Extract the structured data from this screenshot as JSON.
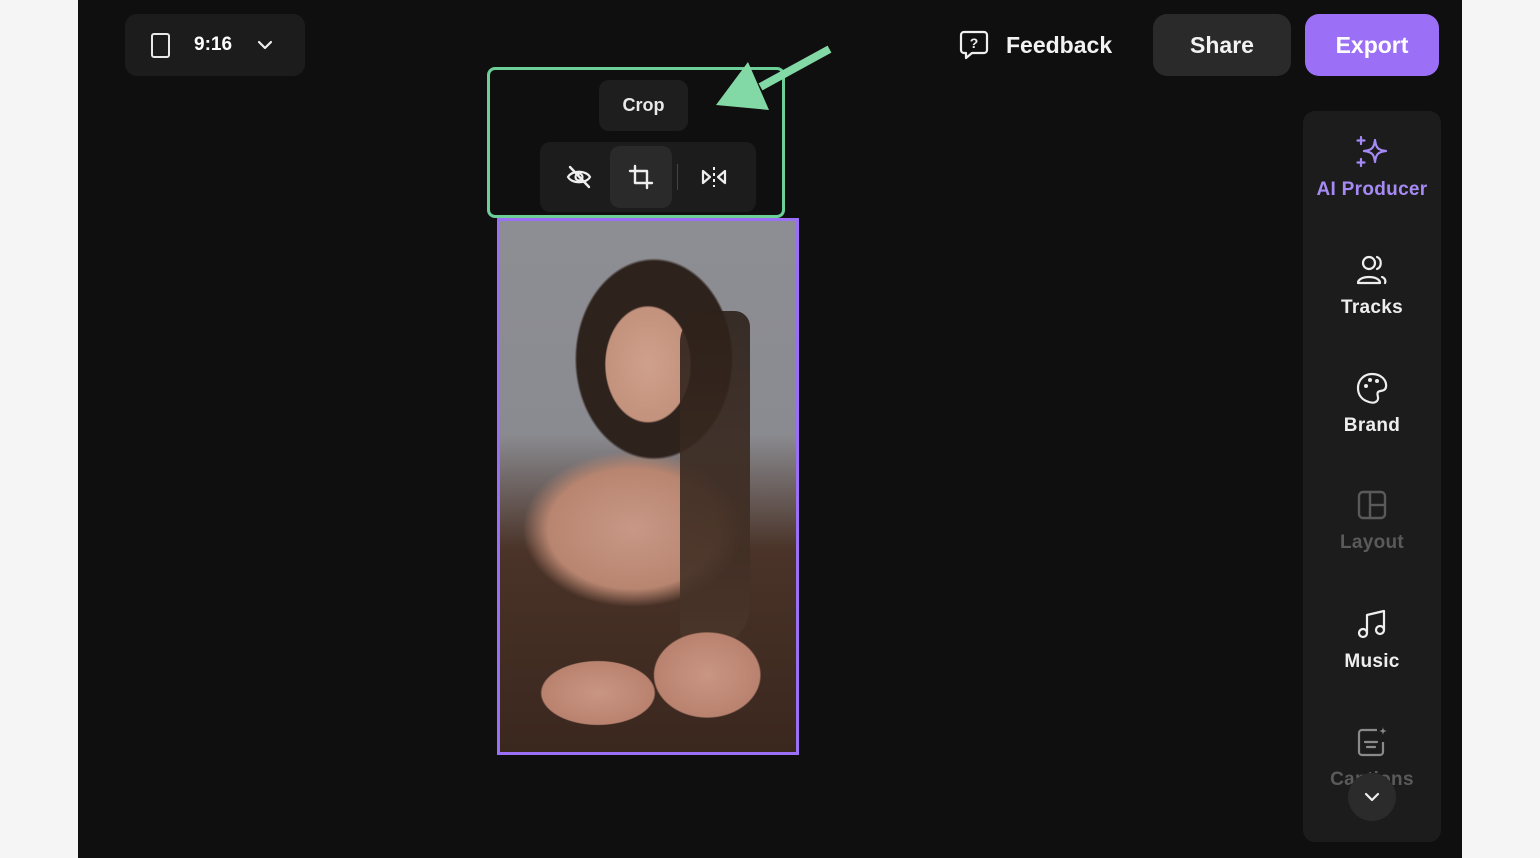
{
  "topbar": {
    "aspect_ratio": "9:16",
    "feedback_label": "Feedback",
    "share_label": "Share",
    "export_label": "Export"
  },
  "toolbar": {
    "tooltip": "Crop",
    "buttons": [
      {
        "name": "hide",
        "icon": "eye-off-icon"
      },
      {
        "name": "crop",
        "icon": "crop-icon",
        "active": true
      },
      {
        "name": "flip",
        "icon": "flip-horizontal-icon"
      }
    ]
  },
  "sidebar": {
    "items": [
      {
        "label": "AI Producer",
        "icon": "sparkles-icon",
        "state": "active"
      },
      {
        "label": "Tracks",
        "icon": "users-icon",
        "state": "normal"
      },
      {
        "label": "Brand",
        "icon": "palette-icon",
        "state": "normal"
      },
      {
        "label": "Layout",
        "icon": "layout-icon",
        "state": "disabled"
      },
      {
        "label": "Music",
        "icon": "music-icon",
        "state": "normal"
      },
      {
        "label": "Captions",
        "icon": "captions-icon",
        "state": "disabled"
      }
    ]
  },
  "colors": {
    "accent": "#9b6ff6",
    "highlight": "#6ccf97",
    "background": "#0f0f0f",
    "panel": "#1c1c1c"
  }
}
